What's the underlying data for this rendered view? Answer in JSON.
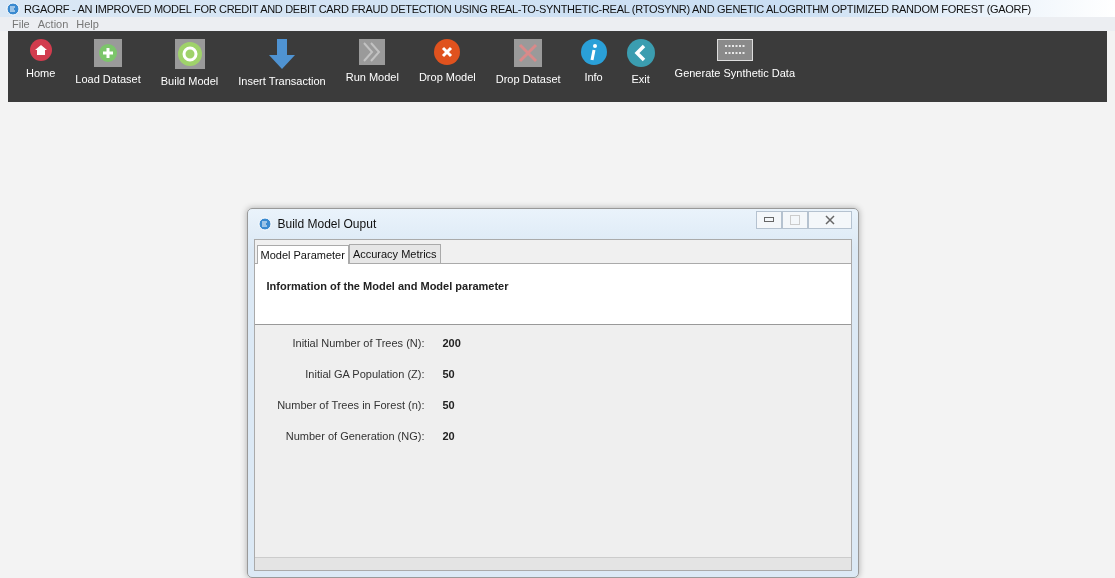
{
  "window": {
    "title": "RGAORF - AN IMPROVED MODEL FOR CREDIT AND DEBIT CARD FRAUD DETECTION USING REAL-TO-SYNTHETIC-REAL (RTOSYNR) AND GENETIC ALOGRITHM OPTIMIZED RANDOM FOREST (GAORF)"
  },
  "menu": [
    "File",
    "Action",
    "Help"
  ],
  "toolbar": [
    {
      "label": "Home",
      "kind": "home"
    },
    {
      "label": "Load Dataset",
      "kind": "plus"
    },
    {
      "label": "Build Model",
      "kind": "ring"
    },
    {
      "label": "Insert Transaction",
      "kind": "down"
    },
    {
      "label": "Run Model",
      "kind": "chevrons"
    },
    {
      "label": "Drop Model",
      "kind": "xcircle"
    },
    {
      "label": "Drop Dataset",
      "kind": "xsquare"
    },
    {
      "label": "Info",
      "kind": "info"
    },
    {
      "label": "Exit",
      "kind": "back"
    },
    {
      "label": "Generate Synthetic Data",
      "kind": "binary"
    }
  ],
  "dialog": {
    "title": "Build Model Ouput",
    "tabs": [
      {
        "label": "Model Parameter",
        "selected": true
      },
      {
        "label": "Accuracy Metrics",
        "selected": false
      }
    ],
    "heading": "Information of the Model and Model parameter",
    "params": [
      {
        "label": "Initial Number of Trees (N):",
        "value": "200"
      },
      {
        "label": "Initial GA Population (Z):",
        "value": "50"
      },
      {
        "label": "Number of Trees in Forest (n):",
        "value": "50"
      },
      {
        "label": "Number of Generation (NG):",
        "value": "20"
      }
    ]
  }
}
